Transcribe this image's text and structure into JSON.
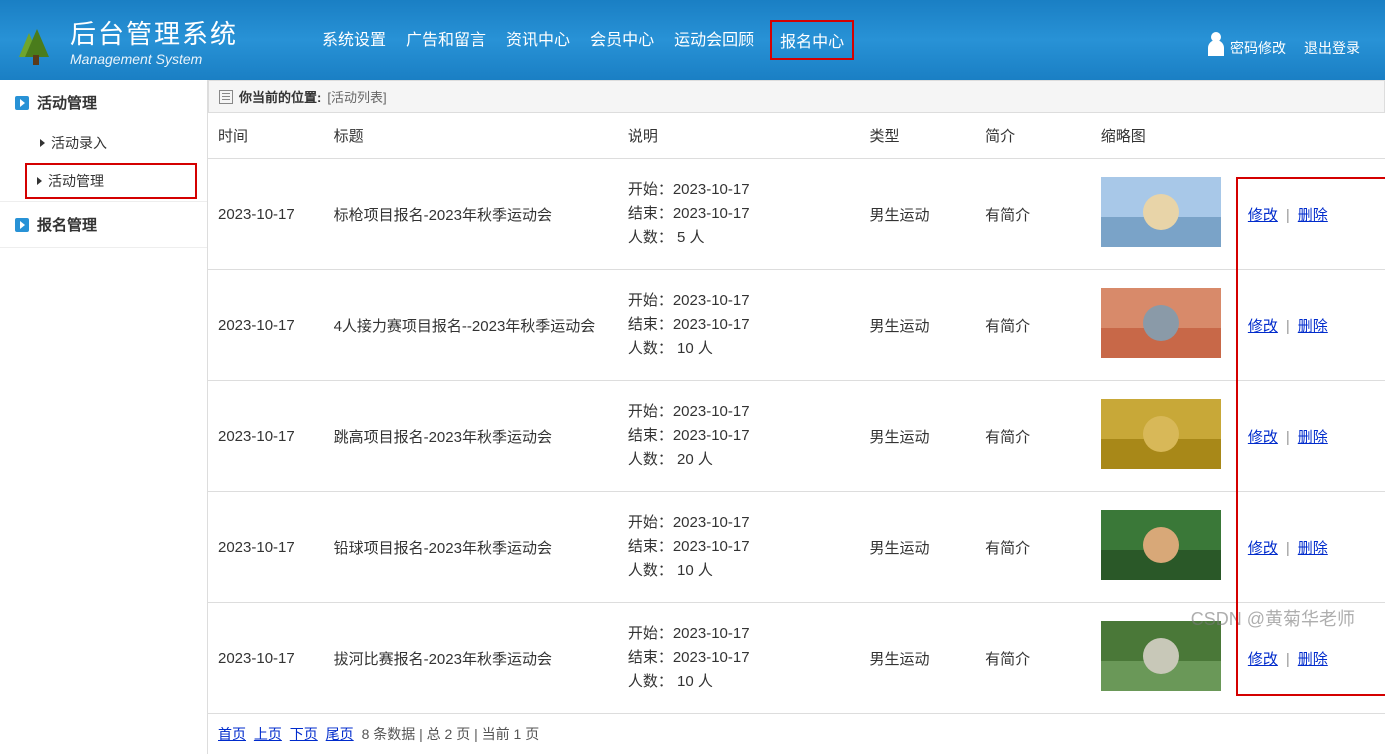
{
  "header": {
    "title": "后台管理系统",
    "subtitle": "Management System",
    "nav": [
      "系统设置",
      "广告和留言",
      "资讯中心",
      "会员中心",
      "运动会回顾",
      "报名中心"
    ],
    "activeNavIndex": 5,
    "changePwd": "密码修改",
    "logout": "退出登录"
  },
  "sidebar": {
    "sections": [
      {
        "title": "活动管理",
        "items": [
          "活动录入",
          "活动管理"
        ],
        "activeIndex": 1
      },
      {
        "title": "报名管理",
        "items": []
      }
    ]
  },
  "breadcrumb": {
    "label": "你当前的位置:",
    "location": "[活动列表]"
  },
  "table": {
    "headers": [
      "时间",
      "标题",
      "说明",
      "类型",
      "简介",
      "缩略图",
      ""
    ],
    "rows": [
      {
        "date": "2023-10-17",
        "title": "标枪项目报名-2023年秋季运动会",
        "start": "开始：2023-10-17",
        "end": "结束：2023-10-17",
        "count": "人数： 5 人",
        "type": "男生运动",
        "intro": "有简介",
        "thumbColors": [
          "#a8c8e8",
          "#7aa3c8",
          "#e8d4a8"
        ]
      },
      {
        "date": "2023-10-17",
        "title": "4人接力赛项目报名--2023年秋季运动会",
        "start": "开始：2023-10-17",
        "end": "结束：2023-10-17",
        "count": "人数： 10 人",
        "type": "男生运动",
        "intro": "有简介",
        "thumbColors": [
          "#d88a6a",
          "#c86848",
          "#8a9aa8"
        ]
      },
      {
        "date": "2023-10-17",
        "title": "跳高项目报名-2023年秋季运动会",
        "start": "开始：2023-10-17",
        "end": "结束：2023-10-17",
        "count": "人数： 20 人",
        "type": "男生运动",
        "intro": "有简介",
        "thumbColors": [
          "#c8a838",
          "#a88818",
          "#d8b858"
        ]
      },
      {
        "date": "2023-10-17",
        "title": "铅球项目报名-2023年秋季运动会",
        "start": "开始：2023-10-17",
        "end": "结束：2023-10-17",
        "count": "人数： 10 人",
        "type": "男生运动",
        "intro": "有简介",
        "thumbColors": [
          "#3a7838",
          "#2a5828",
          "#d8a878"
        ]
      },
      {
        "date": "2023-10-17",
        "title": "拔河比赛报名-2023年秋季运动会",
        "start": "开始：2023-10-17",
        "end": "结束：2023-10-17",
        "count": "人数： 10 人",
        "type": "男生运动",
        "intro": "有简介",
        "thumbColors": [
          "#4a7838",
          "#6a9858",
          "#c8c8b8"
        ]
      }
    ],
    "editLabel": "修改",
    "deleteLabel": "删除"
  },
  "pager": {
    "first": "首页",
    "prev": "上页",
    "next": "下页",
    "last": "尾页",
    "info": "8 条数据 | 总 2 页 | 当前 1 页"
  },
  "watermark": "CSDN @黄菊华老师"
}
